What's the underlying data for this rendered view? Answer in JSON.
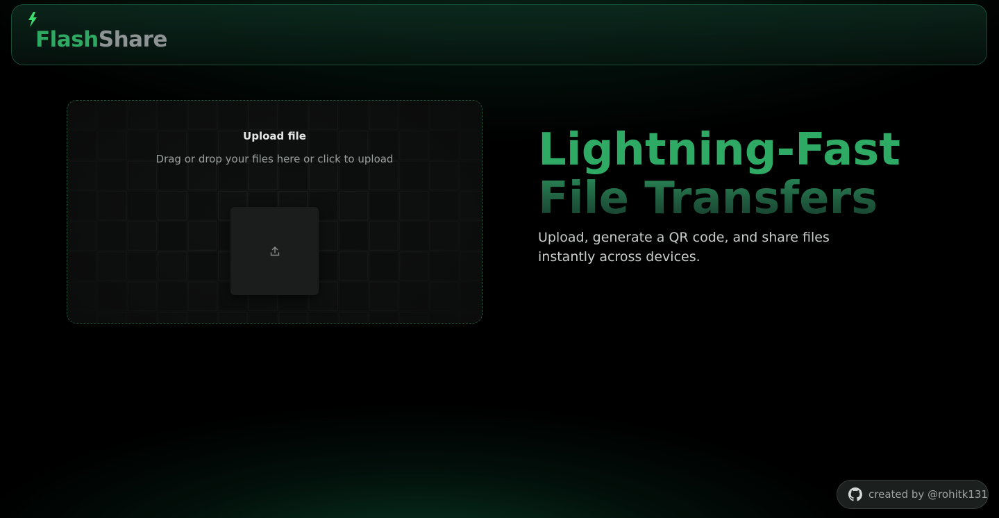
{
  "header": {
    "logo_part1": "Flash",
    "logo_part2": "Share",
    "logo_icon": "lightning-bolt-icon"
  },
  "upload": {
    "title": "Upload file",
    "subtitle": "Drag or drop your files here or click to upload",
    "icon": "upload-icon"
  },
  "hero": {
    "line1": "Lightning-Fast",
    "line2": "File Transfers",
    "description": "Upload, generate a QR code, and share files instantly across devices."
  },
  "footer": {
    "credit": "created by @rohitk131",
    "icon": "github-icon"
  },
  "colors": {
    "accent_green": "#2eaa64",
    "logo_grey": "#8e9494",
    "background": "#000000",
    "card_background": "#0b0c0c"
  }
}
